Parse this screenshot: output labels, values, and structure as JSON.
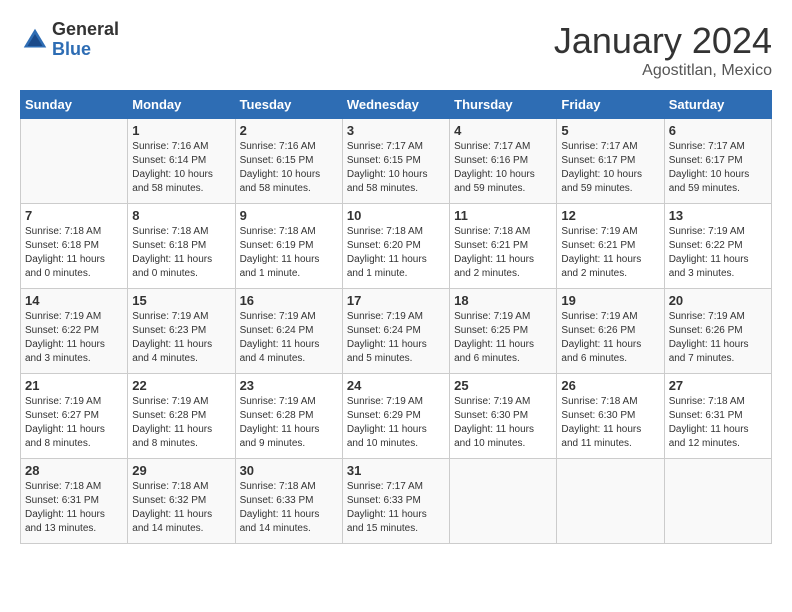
{
  "logo": {
    "general": "General",
    "blue": "Blue"
  },
  "title": "January 2024",
  "subtitle": "Agostitlan, Mexico",
  "days_header": [
    "Sunday",
    "Monday",
    "Tuesday",
    "Wednesday",
    "Thursday",
    "Friday",
    "Saturday"
  ],
  "weeks": [
    [
      {
        "day": "",
        "info": ""
      },
      {
        "day": "1",
        "info": "Sunrise: 7:16 AM\nSunset: 6:14 PM\nDaylight: 10 hours\nand 58 minutes."
      },
      {
        "day": "2",
        "info": "Sunrise: 7:16 AM\nSunset: 6:15 PM\nDaylight: 10 hours\nand 58 minutes."
      },
      {
        "day": "3",
        "info": "Sunrise: 7:17 AM\nSunset: 6:15 PM\nDaylight: 10 hours\nand 58 minutes."
      },
      {
        "day": "4",
        "info": "Sunrise: 7:17 AM\nSunset: 6:16 PM\nDaylight: 10 hours\nand 59 minutes."
      },
      {
        "day": "5",
        "info": "Sunrise: 7:17 AM\nSunset: 6:17 PM\nDaylight: 10 hours\nand 59 minutes."
      },
      {
        "day": "6",
        "info": "Sunrise: 7:17 AM\nSunset: 6:17 PM\nDaylight: 10 hours\nand 59 minutes."
      }
    ],
    [
      {
        "day": "7",
        "info": "Sunrise: 7:18 AM\nSunset: 6:18 PM\nDaylight: 11 hours\nand 0 minutes."
      },
      {
        "day": "8",
        "info": "Sunrise: 7:18 AM\nSunset: 6:18 PM\nDaylight: 11 hours\nand 0 minutes."
      },
      {
        "day": "9",
        "info": "Sunrise: 7:18 AM\nSunset: 6:19 PM\nDaylight: 11 hours\nand 1 minute."
      },
      {
        "day": "10",
        "info": "Sunrise: 7:18 AM\nSunset: 6:20 PM\nDaylight: 11 hours\nand 1 minute."
      },
      {
        "day": "11",
        "info": "Sunrise: 7:18 AM\nSunset: 6:21 PM\nDaylight: 11 hours\nand 2 minutes."
      },
      {
        "day": "12",
        "info": "Sunrise: 7:19 AM\nSunset: 6:21 PM\nDaylight: 11 hours\nand 2 minutes."
      },
      {
        "day": "13",
        "info": "Sunrise: 7:19 AM\nSunset: 6:22 PM\nDaylight: 11 hours\nand 3 minutes."
      }
    ],
    [
      {
        "day": "14",
        "info": "Sunrise: 7:19 AM\nSunset: 6:22 PM\nDaylight: 11 hours\nand 3 minutes."
      },
      {
        "day": "15",
        "info": "Sunrise: 7:19 AM\nSunset: 6:23 PM\nDaylight: 11 hours\nand 4 minutes."
      },
      {
        "day": "16",
        "info": "Sunrise: 7:19 AM\nSunset: 6:24 PM\nDaylight: 11 hours\nand 4 minutes."
      },
      {
        "day": "17",
        "info": "Sunrise: 7:19 AM\nSunset: 6:24 PM\nDaylight: 11 hours\nand 5 minutes."
      },
      {
        "day": "18",
        "info": "Sunrise: 7:19 AM\nSunset: 6:25 PM\nDaylight: 11 hours\nand 6 minutes."
      },
      {
        "day": "19",
        "info": "Sunrise: 7:19 AM\nSunset: 6:26 PM\nDaylight: 11 hours\nand 6 minutes."
      },
      {
        "day": "20",
        "info": "Sunrise: 7:19 AM\nSunset: 6:26 PM\nDaylight: 11 hours\nand 7 minutes."
      }
    ],
    [
      {
        "day": "21",
        "info": "Sunrise: 7:19 AM\nSunset: 6:27 PM\nDaylight: 11 hours\nand 8 minutes."
      },
      {
        "day": "22",
        "info": "Sunrise: 7:19 AM\nSunset: 6:28 PM\nDaylight: 11 hours\nand 8 minutes."
      },
      {
        "day": "23",
        "info": "Sunrise: 7:19 AM\nSunset: 6:28 PM\nDaylight: 11 hours\nand 9 minutes."
      },
      {
        "day": "24",
        "info": "Sunrise: 7:19 AM\nSunset: 6:29 PM\nDaylight: 11 hours\nand 10 minutes."
      },
      {
        "day": "25",
        "info": "Sunrise: 7:19 AM\nSunset: 6:30 PM\nDaylight: 11 hours\nand 10 minutes."
      },
      {
        "day": "26",
        "info": "Sunrise: 7:18 AM\nSunset: 6:30 PM\nDaylight: 11 hours\nand 11 minutes."
      },
      {
        "day": "27",
        "info": "Sunrise: 7:18 AM\nSunset: 6:31 PM\nDaylight: 11 hours\nand 12 minutes."
      }
    ],
    [
      {
        "day": "28",
        "info": "Sunrise: 7:18 AM\nSunset: 6:31 PM\nDaylight: 11 hours\nand 13 minutes."
      },
      {
        "day": "29",
        "info": "Sunrise: 7:18 AM\nSunset: 6:32 PM\nDaylight: 11 hours\nand 14 minutes."
      },
      {
        "day": "30",
        "info": "Sunrise: 7:18 AM\nSunset: 6:33 PM\nDaylight: 11 hours\nand 14 minutes."
      },
      {
        "day": "31",
        "info": "Sunrise: 7:17 AM\nSunset: 6:33 PM\nDaylight: 11 hours\nand 15 minutes."
      },
      {
        "day": "",
        "info": ""
      },
      {
        "day": "",
        "info": ""
      },
      {
        "day": "",
        "info": ""
      }
    ]
  ]
}
